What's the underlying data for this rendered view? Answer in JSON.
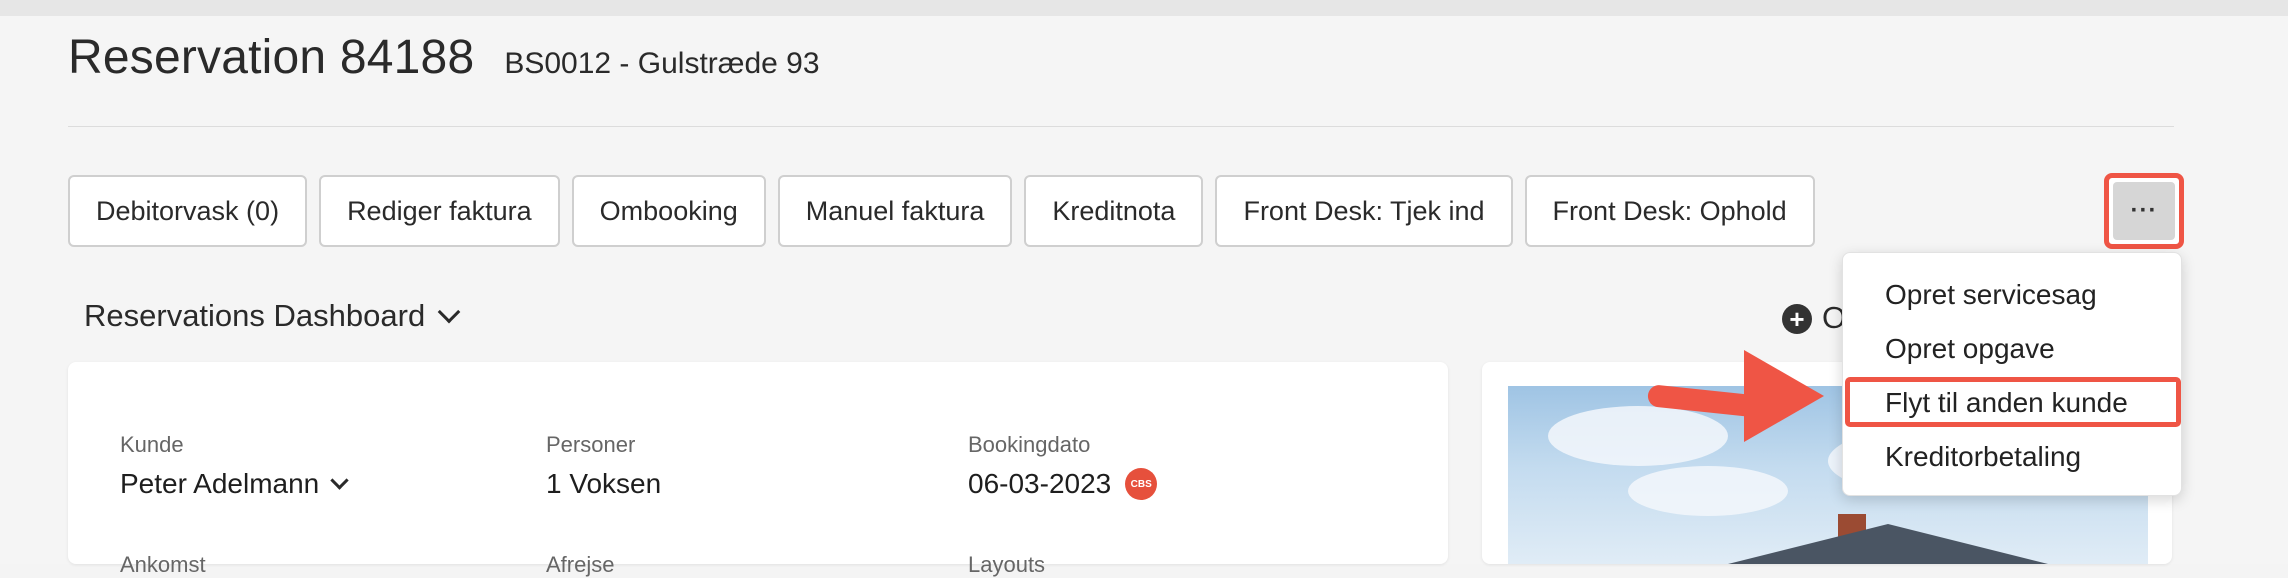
{
  "header": {
    "title": "Reservation 84188",
    "subtitle": "BS0012 - Gulstræde 93"
  },
  "toolbar": {
    "buttons": [
      "Debitorvask (0)",
      "Rediger faktura",
      "Ombooking",
      "Manuel faktura",
      "Kreditnota",
      "Front Desk: Tjek ind",
      "Front Desk: Ophold"
    ],
    "more_label": "···"
  },
  "dashboard": {
    "title": "Reservations Dashboard",
    "add_label": "O"
  },
  "details": {
    "kunde_label": "Kunde",
    "kunde_value": "Peter Adelmann",
    "personer_label": "Personer",
    "personer_value": "1 Voksen",
    "bookingdato_label": "Bookingdato",
    "bookingdato_value": "06-03-2023",
    "cbs_badge": "CBS",
    "partial_1": "Ankomst",
    "partial_2": "Afrejse",
    "partial_3": "Layouts"
  },
  "dropdown_menu": {
    "items": [
      "Opret servicesag",
      "Opret opgave",
      "Flyt til anden kunde",
      "Kreditorbetaling"
    ],
    "highlighted_index": 2
  },
  "colors": {
    "highlight": "#ef5545",
    "badge": "#e6503c",
    "background": "#f5f5f5"
  }
}
